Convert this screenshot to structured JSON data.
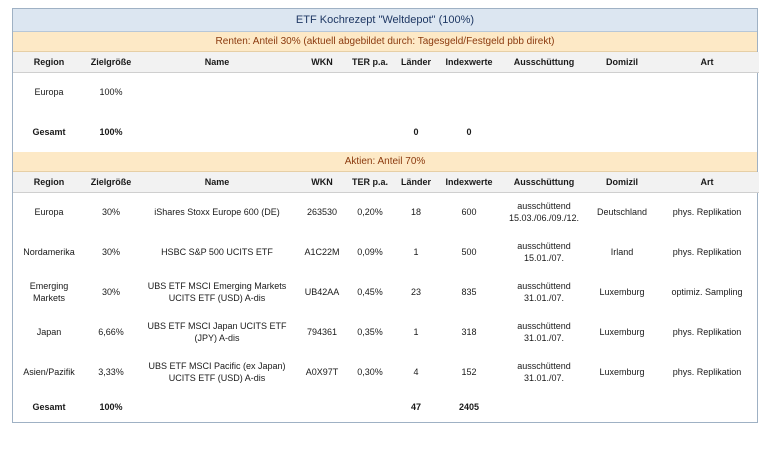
{
  "title": "ETF Kochrezept \"Weltdepot\" (100%)",
  "columns": [
    "Region",
    "Zielgröße",
    "Name",
    "WKN",
    "TER p.a.",
    "Länder",
    "Indexwerte",
    "Ausschüttung",
    "Domizil",
    "Art"
  ],
  "renten": {
    "heading": "Renten: Anteil 30% (aktuell abgebildet durch: Tagesgeld/Festgeld pbb direkt)",
    "rows": [
      {
        "region": "Europa",
        "ziel": "100%",
        "name": "",
        "wkn": "",
        "ter": "",
        "laender": "",
        "index": "",
        "aus": "",
        "domizil": "",
        "art": ""
      }
    ],
    "total": {
      "region": "Gesamt",
      "ziel": "100%",
      "laender": "0",
      "index": "0"
    }
  },
  "aktien": {
    "heading": "Aktien: Anteil 70%",
    "rows": [
      {
        "region": "Europa",
        "ziel": "30%",
        "name": "iShares Stoxx Europe 600 (DE)",
        "wkn": "263530",
        "ter": "0,20%",
        "laender": "18",
        "index": "600",
        "aus": "ausschüttend 15.03./06./09./12.",
        "domizil": "Deutschland",
        "art": "phys. Replikation"
      },
      {
        "region": "Nordamerika",
        "ziel": "30%",
        "name": "HSBC S&P 500 UCITS ETF",
        "wkn": "A1C22M",
        "ter": "0,09%",
        "laender": "1",
        "index": "500",
        "aus": "ausschüttend 15.01./07.",
        "domizil": "Irland",
        "art": "phys. Replikation"
      },
      {
        "region": "Emerging Markets",
        "ziel": "30%",
        "name": "UBS ETF MSCI Emerging Markets UCITS ETF (USD) A-dis",
        "wkn": "UB42AA",
        "ter": "0,45%",
        "laender": "23",
        "index": "835",
        "aus": "ausschüttend 31.01./07.",
        "domizil": "Luxemburg",
        "art": "optimiz. Sampling"
      },
      {
        "region": "Japan",
        "ziel": "6,66%",
        "name": "UBS ETF MSCI Japan UCITS ETF (JPY) A-dis",
        "wkn": "794361",
        "ter": "0,35%",
        "laender": "1",
        "index": "318",
        "aus": "ausschüttend 31.01./07.",
        "domizil": "Luxemburg",
        "art": "phys. Replikation"
      },
      {
        "region": "Asien/Pazifik",
        "ziel": "3,33%",
        "name": "UBS ETF MSCI Pacific (ex Japan) UCITS ETF (USD) A-dis",
        "wkn": "A0X97T",
        "ter": "0,30%",
        "laender": "4",
        "index": "152",
        "aus": "ausschüttend 31.01./07.",
        "domizil": "Luxemburg",
        "art": "phys. Replikation"
      }
    ],
    "total": {
      "region": "Gesamt",
      "ziel": "100%",
      "laender": "47",
      "index": "2405"
    }
  }
}
